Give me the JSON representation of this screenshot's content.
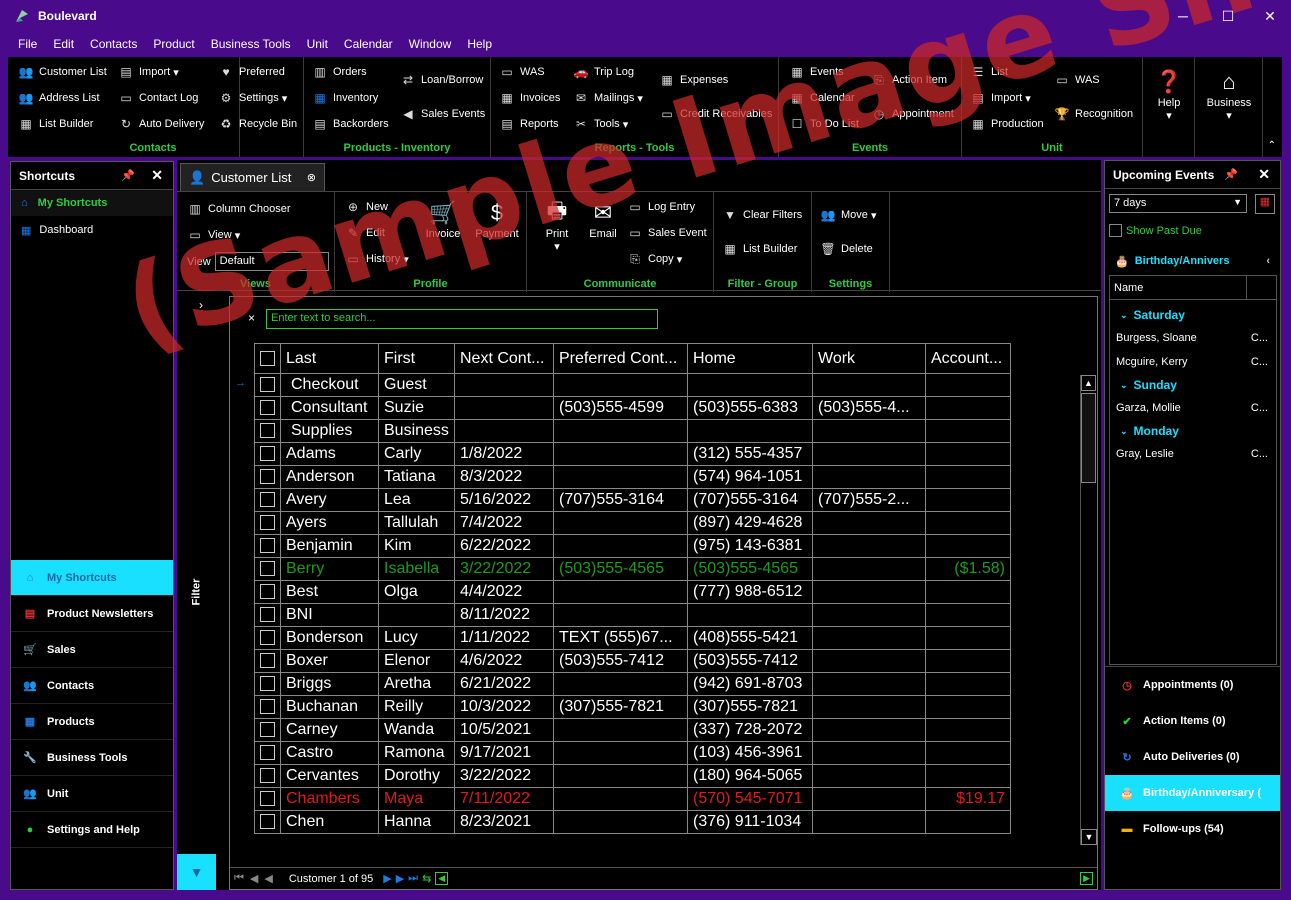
{
  "window": {
    "title": "Boulevard",
    "minimize": "─",
    "maximize": "☐",
    "close": "✕"
  },
  "menu": [
    "File",
    "Edit",
    "Contacts",
    "Product",
    "Business Tools",
    "Unit",
    "Calendar",
    "Window",
    "Help"
  ],
  "ribbon": {
    "contacts": {
      "title": "Contacts",
      "items": [
        "Customer List",
        "Address List",
        "List Builder",
        "Import",
        "Contact Log",
        "Auto Delivery",
        "Preferred",
        "Settings",
        "Recycle Bin"
      ]
    },
    "products": {
      "title": "Products - Inventory",
      "items": [
        "Orders",
        "Inventory",
        "Backorders",
        "Loan/Borrow",
        "Sales Events"
      ]
    },
    "reports": {
      "title": "Reports - Tools",
      "items": [
        "WAS",
        "Invoices",
        "Reports",
        "Trip Log",
        "Mailings",
        "Tools",
        "Expenses",
        "Credit Receivables"
      ]
    },
    "events": {
      "title": "Events",
      "items": [
        "Events",
        "Calendar",
        "To Do List",
        "Action Item",
        "Appointment"
      ]
    },
    "unit": {
      "title": "Unit",
      "items": [
        "List",
        "Import",
        "Production",
        "WAS",
        "Recognition"
      ]
    },
    "help": "Help",
    "business": "Business"
  },
  "shortcuts": {
    "title": "Shortcuts",
    "header": "My Shortcuts",
    "items": [
      "Dashboard"
    ],
    "nav": [
      "My Shortcuts",
      "Product Newsletters",
      "Sales",
      "Contacts",
      "Products",
      "Business Tools",
      "Unit",
      "Settings and Help"
    ]
  },
  "doc": {
    "tab": "Customer List",
    "views": {
      "title": "Views",
      "column_chooser": "Column Chooser",
      "view": "View",
      "view_label": "View",
      "view_value": "Default"
    },
    "profile": {
      "title": "Profile",
      "new": "New",
      "edit": "Edit",
      "history": "History",
      "invoice": "Invoice",
      "payment": "Payment"
    },
    "communicate": {
      "title": "Communicate",
      "print": "Print",
      "email": "Email",
      "log_entry": "Log Entry",
      "sales_event": "Sales Event",
      "copy": "Copy"
    },
    "filter": {
      "title": "Filter - Group",
      "clear": "Clear Filters",
      "list_builder": "List Builder"
    },
    "settings": {
      "title": "Settings",
      "move": "Move",
      "delete": "Delete"
    }
  },
  "grid": {
    "search_placeholder": "Enter text to search...",
    "columns": [
      "Last",
      "First",
      "Next Cont...",
      "Preferred Cont...",
      "Home",
      "Work",
      "Account..."
    ],
    "rows": [
      [
        "Checkout",
        "Guest",
        "",
        "",
        "",
        "",
        ""
      ],
      [
        "Consultant",
        "Suzie",
        "",
        "(503)555-4599",
        "(503)555-6383",
        "(503)555-4...",
        ""
      ],
      [
        "Supplies",
        "Business",
        "",
        "",
        "",
        "",
        ""
      ],
      [
        "Adams",
        "Carly",
        "1/8/2022",
        "",
        "(312) 555-4357",
        "",
        ""
      ],
      [
        "Anderson",
        "Tatiana",
        "8/3/2022",
        "",
        "(574) 964-1051",
        "",
        ""
      ],
      [
        "Avery",
        "Lea",
        "5/16/2022",
        "(707)555-3164",
        "(707)555-3164",
        "(707)555-2...",
        ""
      ],
      [
        "Ayers",
        "Tallulah",
        "7/4/2022",
        "",
        "(897) 429-4628",
        "",
        ""
      ],
      [
        "Benjamin",
        "Kim",
        "6/22/2022",
        "",
        "(975) 143-6381",
        "",
        ""
      ],
      [
        "Berry",
        "Isabella",
        "3/22/2022",
        "(503)555-4565",
        "(503)555-4565",
        "",
        "($1.58)"
      ],
      [
        "Best",
        "Olga",
        "4/4/2022",
        "",
        "(777) 988-6512",
        "",
        ""
      ],
      [
        "BNI",
        "",
        "8/11/2022",
        "",
        "",
        "",
        ""
      ],
      [
        "Bonderson",
        "Lucy",
        "1/11/2022",
        "TEXT (555)67...",
        "(408)555-5421",
        "",
        ""
      ],
      [
        "Boxer",
        "Elenor",
        "4/6/2022",
        "(503)555-7412",
        "(503)555-7412",
        "",
        ""
      ],
      [
        "Briggs",
        "Aretha",
        "6/21/2022",
        "",
        "(942) 691-8703",
        "",
        ""
      ],
      [
        "Buchanan",
        "Reilly",
        "10/3/2022",
        "(307)555-7821",
        "(307)555-7821",
        "",
        ""
      ],
      [
        "Carney",
        "Wanda",
        "10/5/2021",
        "",
        "(337) 728-2072",
        "",
        ""
      ],
      [
        "Castro",
        "Ramona",
        "9/17/2021",
        "",
        "(103) 456-3961",
        "",
        ""
      ],
      [
        "Cervantes",
        "Dorothy",
        "3/22/2022",
        "",
        "(180) 964-5065",
        "",
        ""
      ],
      [
        "Chambers",
        "Maya",
        "7/11/2022",
        "",
        "(570) 545-7071",
        "",
        "$19.17"
      ],
      [
        "Chen",
        "Hanna",
        "8/23/2021",
        "",
        "(376) 911-1034",
        "",
        ""
      ]
    ],
    "pager": "Customer 1 of 95",
    "filter_label": "Filter"
  },
  "events": {
    "title": "Upcoming Events",
    "range": "7 days",
    "show_past_due": "Show Past Due",
    "section": "Birthday/Annivers",
    "name_header": "Name",
    "days": [
      {
        "day": "Saturday",
        "people": [
          {
            "name": "Burgess, Sloane",
            "code": "C..."
          },
          {
            "name": "Mcguire, Kerry",
            "code": "C..."
          }
        ]
      },
      {
        "day": "Sunday",
        "people": [
          {
            "name": "Garza, Mollie",
            "code": "C..."
          }
        ]
      },
      {
        "day": "Monday",
        "people": [
          {
            "name": "Gray, Leslie",
            "code": "C..."
          }
        ]
      }
    ],
    "bottom": [
      "Appointments (0)",
      "Action Items (0)",
      "Auto Deliveries (0)",
      "Birthday/Anniversary (",
      "Follow-ups (54)"
    ]
  },
  "watermark": "(Sample Image Shown)",
  "colors": {
    "accent": "#2ecc40",
    "cyan": "#19e0ff",
    "frame": "#4a0a8c"
  }
}
